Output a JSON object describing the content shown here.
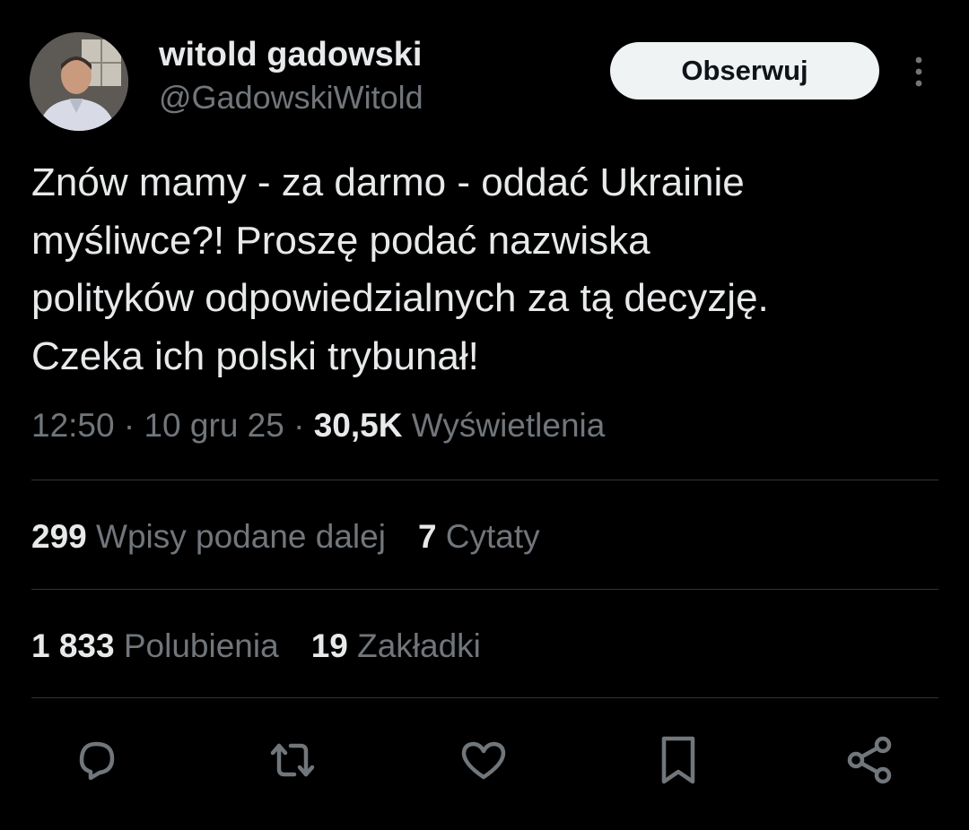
{
  "author": {
    "display_name": "witold gadowski",
    "handle": "@GadowskiWitold"
  },
  "follow_button_label": "Obserwuj",
  "tweet": {
    "text": "Znów mamy - za darmo - oddać Ukrainie\nmyśliwce?! Proszę podać nazwiska\npolityków odpowiedzialnych za tą decyzję.\nCzeka ich polski trybunał!"
  },
  "meta": {
    "time": "12:50",
    "separator": " · ",
    "date": "10 gru 25",
    "views_count": "30,5K",
    "views_label": "Wyświetlenia"
  },
  "stats": {
    "reposts_count": "299",
    "reposts_label": "Wpisy podane dalej",
    "quotes_count": "7",
    "quotes_label": "Cytaty",
    "likes_count": "1 833",
    "likes_label": "Polubienia",
    "bookmarks_count": "19",
    "bookmarks_label": "Zakładki"
  },
  "actions": [
    "reply-icon",
    "repost-icon",
    "like-icon",
    "bookmark-icon",
    "share-icon"
  ],
  "colors": {
    "background": "#000000",
    "text_primary": "#e7e9ea",
    "text_secondary": "#71767b",
    "divider": "#2f3336",
    "button_bg": "#eff3f4",
    "button_text": "#0f1419"
  }
}
